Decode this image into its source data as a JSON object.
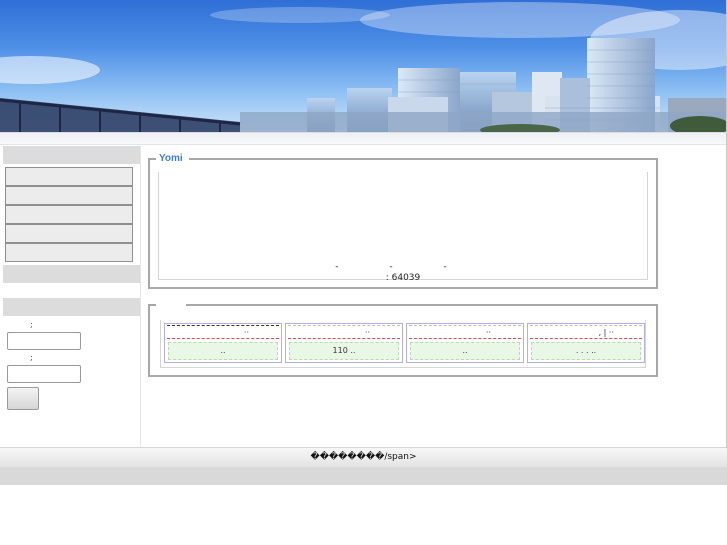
{
  "banner": {
    "image": "city-skyline-photo",
    "sky_color": "#4d8ee6"
  },
  "sidebar": {
    "menu_items": [
      {
        "label": ""
      },
      {
        "label": ""
      },
      {
        "label": ""
      },
      {
        "label": ""
      },
      {
        "label": ""
      }
    ],
    "login": {
      "user_label": ";",
      "password_label": ";",
      "user_value": "",
      "password_value": "",
      "submit_label": ""
    }
  },
  "yomi_panel": {
    "title": "Yomi",
    "separator_line": "- - -",
    "counter_text": ": 64039"
  },
  "calendar_panel": {
    "title": "",
    "cells": [
      {
        "top": "··",
        "bottom": ".."
      },
      {
        "top": "··",
        "bottom": "110        .."
      },
      {
        "top": "··",
        "bottom": ".."
      },
      {
        "top": ",     |  ··",
        "bottom": ". .        .        .."
      }
    ]
  },
  "footer": {
    "text": "��������/span>"
  },
  "colors": {
    "accent_title": "#3d7fd6",
    "panel_border": "#a8a8a8",
    "calendar_border": "#b3aee6",
    "calendar_bottom_bg": "#e9f8e6",
    "dashed_red": "#e0474e"
  }
}
